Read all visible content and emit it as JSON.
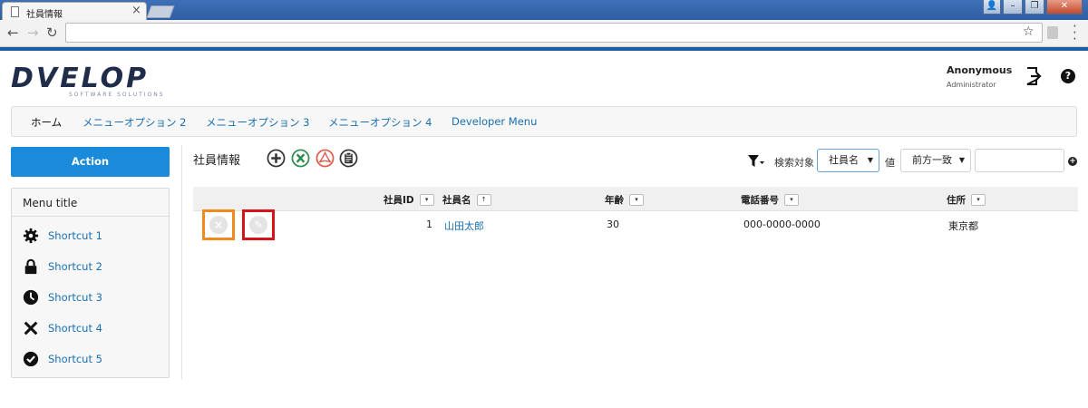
{
  "browser": {
    "tab_title": "社員情報",
    "tab_close": "×",
    "url": "",
    "window_buttons": [
      "👤",
      "–",
      "❐",
      "✕"
    ]
  },
  "header": {
    "logo_text": "DVELOP",
    "logo_tagline": "SOFTWARE SOLUTIONS",
    "user_name": "Anonymous",
    "user_role": "Administrator",
    "help_label": "?"
  },
  "nav": {
    "items": [
      {
        "label": "ホーム",
        "active": true
      },
      {
        "label": "メニューオプション 2",
        "active": false
      },
      {
        "label": "メニューオプション 3",
        "active": false
      },
      {
        "label": "メニューオプション 4",
        "active": false
      },
      {
        "label": "Developer Menu",
        "active": false
      }
    ]
  },
  "sidebar": {
    "action_label": "Action",
    "menu_title": "Menu title",
    "shortcuts": [
      {
        "label": "Shortcut 1",
        "icon": "gear-icon"
      },
      {
        "label": "Shortcut 2",
        "icon": "lock-icon"
      },
      {
        "label": "Shortcut 3",
        "icon": "clock-icon"
      },
      {
        "label": "Shortcut 4",
        "icon": "close-icon"
      },
      {
        "label": "Shortcut 5",
        "icon": "check-circle-icon"
      }
    ]
  },
  "main": {
    "title": "社員情報",
    "toolbar_icons": [
      "add-circle-icon",
      "excel-icon",
      "pdf-icon",
      "clipboard-icon"
    ],
    "search": {
      "target_label": "検索対象",
      "target_value": "社員名",
      "value_label": "値",
      "match_value": "前方一致",
      "query": "",
      "add_label": "+"
    }
  },
  "table": {
    "columns": [
      {
        "label": "社員ID",
        "sort": "▾"
      },
      {
        "label": "社員名",
        "sort": "↑"
      },
      {
        "label": "年齢",
        "sort": "▾"
      },
      {
        "label": "電話番号",
        "sort": "▾"
      },
      {
        "label": "住所",
        "sort": "▾"
      }
    ],
    "rows": [
      {
        "id": "1",
        "name": "山田太郎",
        "age": "30",
        "phone": "000-0000-0000",
        "address": "東京都"
      }
    ],
    "row_actions": {
      "delete": "×",
      "edit": "✎"
    }
  },
  "colors": {
    "accent": "#1a8adb",
    "link": "#1a6fb0",
    "delete_highlight": "#f08c1e",
    "edit_highlight": "#d6131b"
  }
}
